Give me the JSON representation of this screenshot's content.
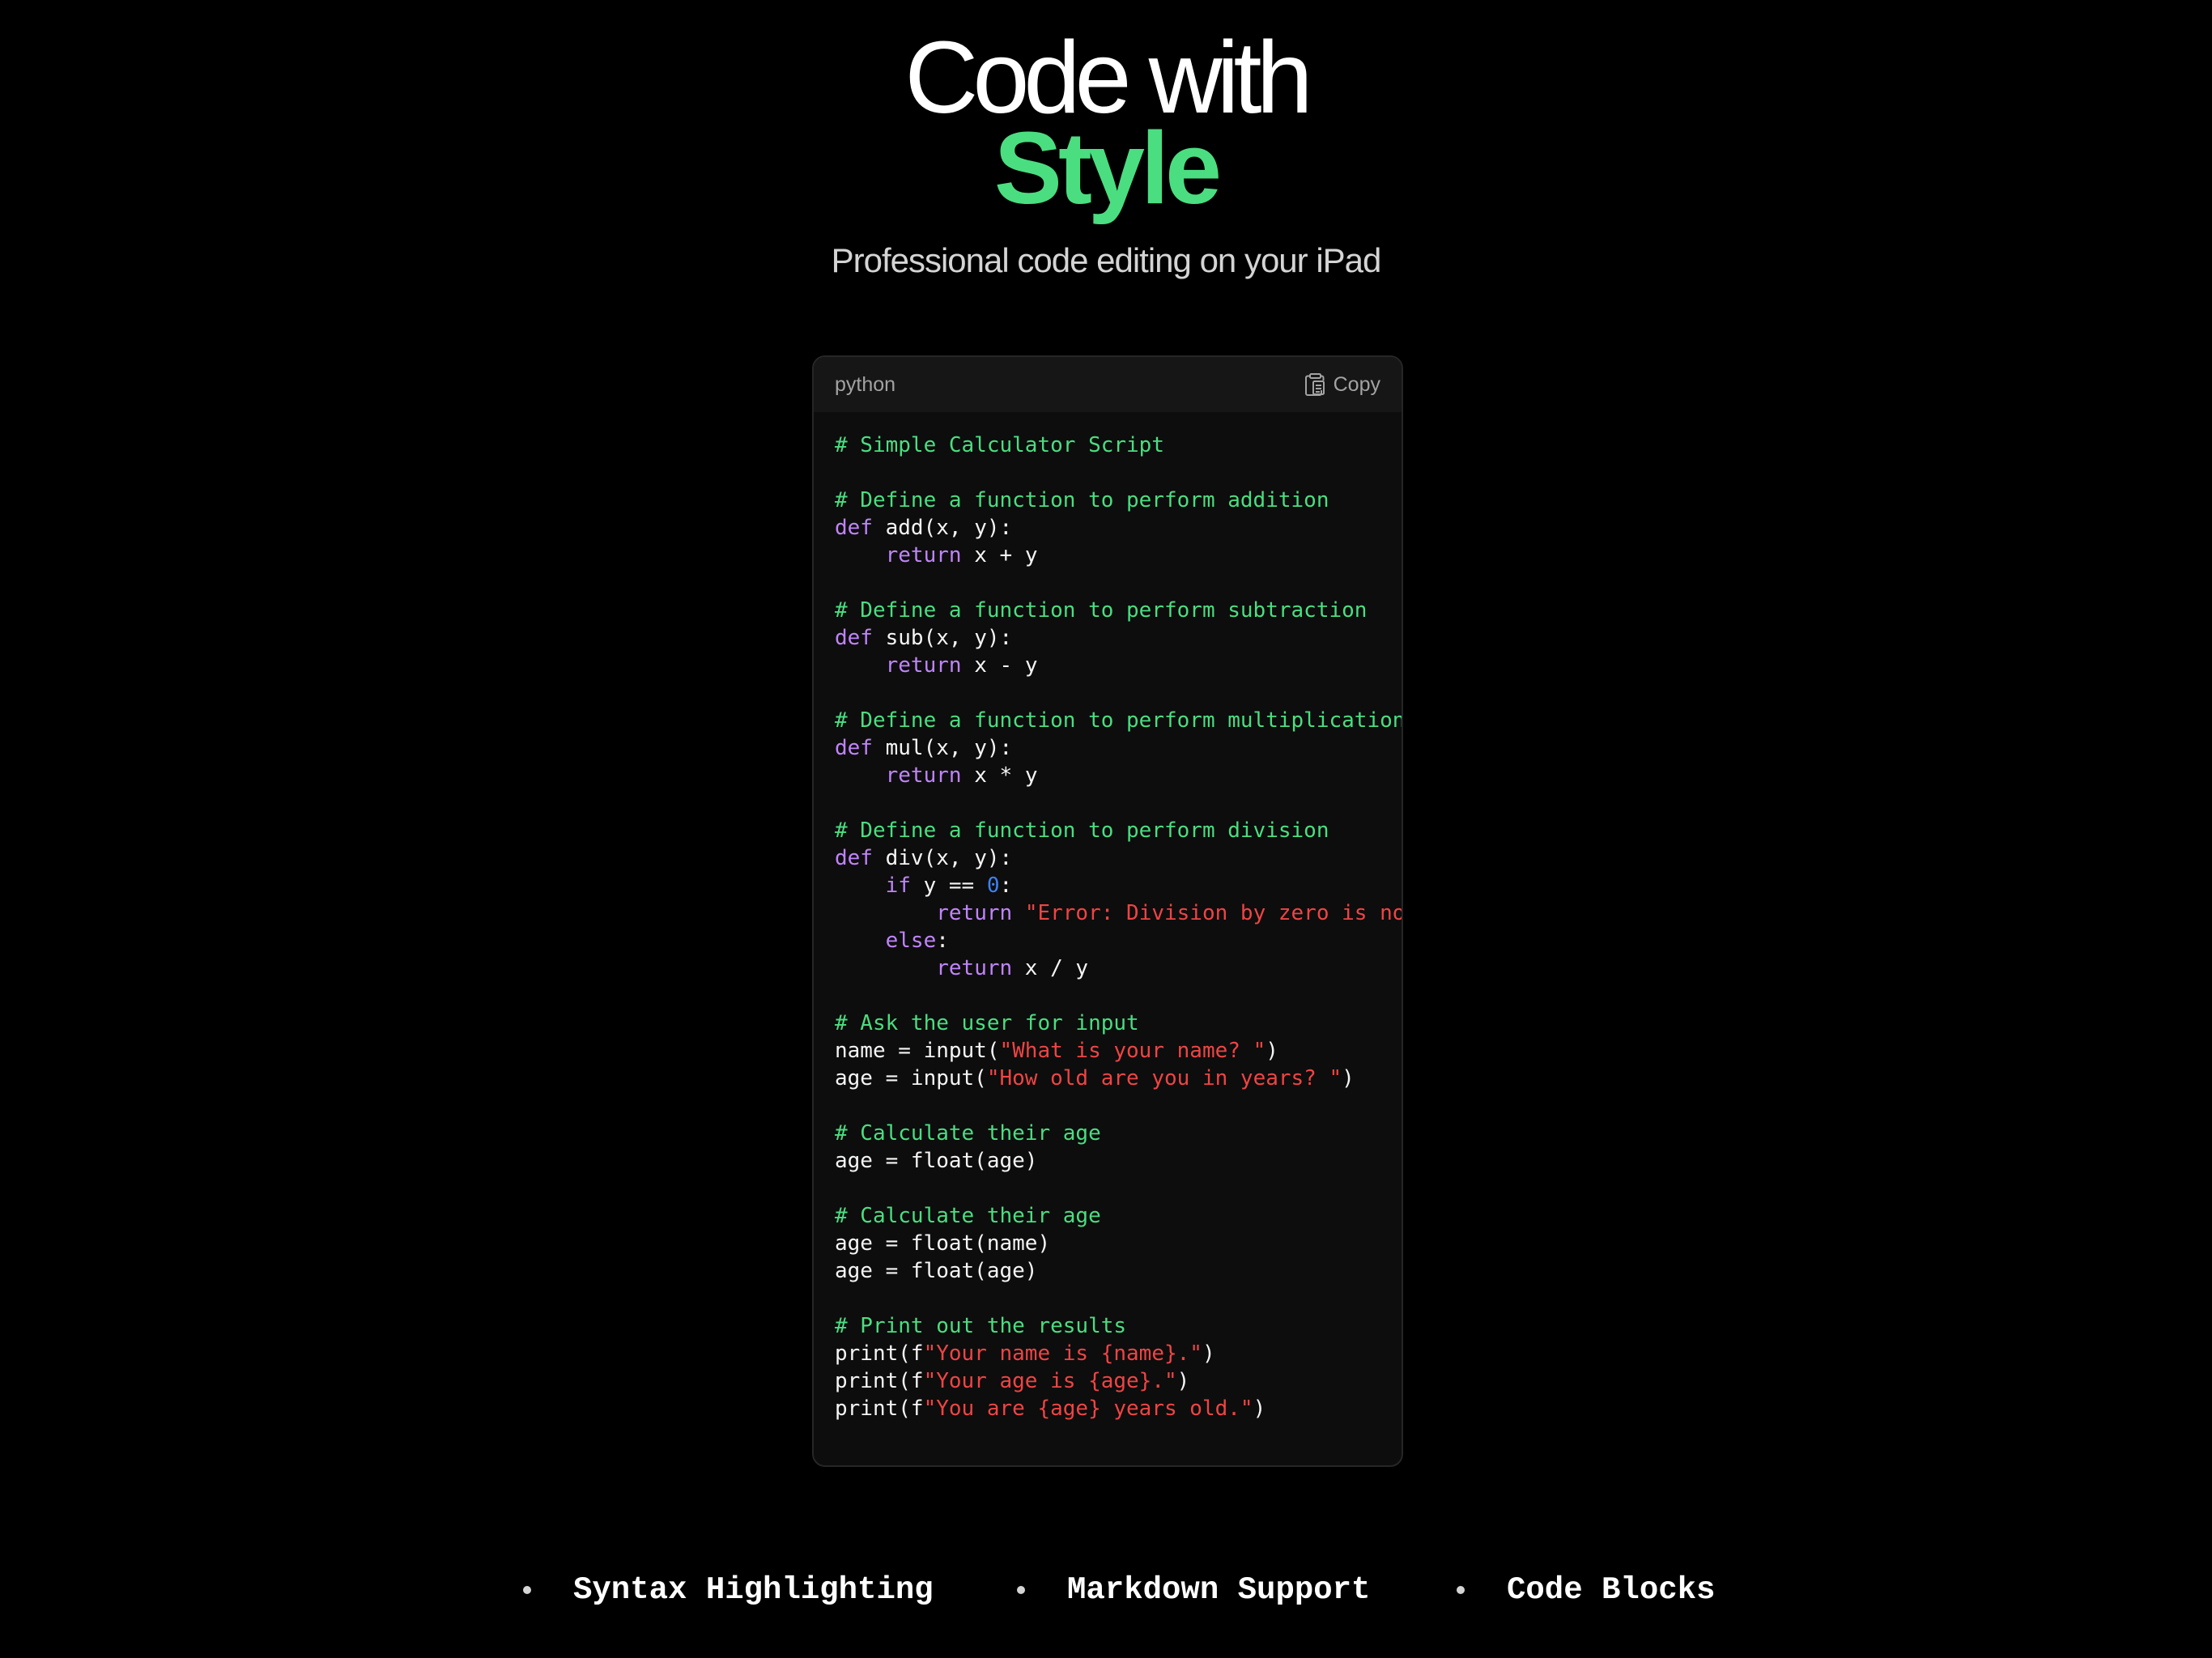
{
  "hero": {
    "title_line1": "Code with",
    "title_line2": "Style",
    "subtitle": "Professional code editing on your iPad"
  },
  "code_block": {
    "language": "python",
    "copy_label": "Copy",
    "copy_icon": "clipboard-icon",
    "lines": [
      [
        [
          "comment",
          "# Simple Calculator Script"
        ]
      ],
      [],
      [
        [
          "comment",
          "# Define a function to perform addition"
        ]
      ],
      [
        [
          "keyword",
          "def"
        ],
        [
          "plain",
          " add(x, y):"
        ]
      ],
      [
        [
          "plain",
          "    "
        ],
        [
          "keyword",
          "return"
        ],
        [
          "plain",
          " x + y"
        ]
      ],
      [],
      [
        [
          "comment",
          "# Define a function to perform subtraction"
        ]
      ],
      [
        [
          "keyword",
          "def"
        ],
        [
          "plain",
          " sub(x, y):"
        ]
      ],
      [
        [
          "plain",
          "    "
        ],
        [
          "keyword",
          "return"
        ],
        [
          "plain",
          " x - y"
        ]
      ],
      [],
      [
        [
          "comment",
          "# Define a function to perform multiplication"
        ]
      ],
      [
        [
          "keyword",
          "def"
        ],
        [
          "plain",
          " mul(x, y):"
        ]
      ],
      [
        [
          "plain",
          "    "
        ],
        [
          "keyword",
          "return"
        ],
        [
          "plain",
          " x * y"
        ]
      ],
      [],
      [
        [
          "comment",
          "# Define a function to perform division"
        ]
      ],
      [
        [
          "keyword",
          "def"
        ],
        [
          "plain",
          " div(x, y):"
        ]
      ],
      [
        [
          "plain",
          "    "
        ],
        [
          "keyword",
          "if"
        ],
        [
          "plain",
          " y == "
        ],
        [
          "number",
          "0"
        ],
        [
          "plain",
          ":"
        ]
      ],
      [
        [
          "plain",
          "        "
        ],
        [
          "keyword",
          "return"
        ],
        [
          "plain",
          " "
        ],
        [
          "string",
          "\"Error: Division by zero is no"
        ]
      ],
      [
        [
          "plain",
          "    "
        ],
        [
          "keyword",
          "else"
        ],
        [
          "plain",
          ":"
        ]
      ],
      [
        [
          "plain",
          "        "
        ],
        [
          "keyword",
          "return"
        ],
        [
          "plain",
          " x / y"
        ]
      ],
      [],
      [
        [
          "comment",
          "# Ask the user for input"
        ]
      ],
      [
        [
          "plain",
          "name = input("
        ],
        [
          "string",
          "\"What is your name? \""
        ],
        [
          "plain",
          ")"
        ]
      ],
      [
        [
          "plain",
          "age = input("
        ],
        [
          "string",
          "\"How old are you in years? \""
        ],
        [
          "plain",
          ")"
        ]
      ],
      [],
      [
        [
          "comment",
          "# Calculate their age"
        ]
      ],
      [
        [
          "plain",
          "age = float(age)"
        ]
      ],
      [],
      [
        [
          "comment",
          "# Calculate their age"
        ]
      ],
      [
        [
          "plain",
          "age = float(name)"
        ]
      ],
      [
        [
          "plain",
          "age = float(age)"
        ]
      ],
      [],
      [
        [
          "comment",
          "# Print out the results"
        ]
      ],
      [
        [
          "plain",
          "print(f"
        ],
        [
          "string",
          "\"Your name is {name}.\""
        ],
        [
          "plain",
          ")"
        ]
      ],
      [
        [
          "plain",
          "print(f"
        ],
        [
          "string",
          "\"Your age is {age}.\""
        ],
        [
          "plain",
          ")"
        ]
      ],
      [
        [
          "plain",
          "print(f"
        ],
        [
          "string",
          "\"You are {age} years old.\""
        ],
        [
          "plain",
          ")"
        ]
      ]
    ]
  },
  "features": [
    {
      "label": "Syntax Highlighting"
    },
    {
      "label": "Markdown Support"
    },
    {
      "label": "Code Blocks"
    }
  ],
  "colors": {
    "background": "#000000",
    "accent": "#4ade80",
    "keyword": "#c084fc",
    "string": "#ef4444",
    "number": "#3b82f6"
  }
}
